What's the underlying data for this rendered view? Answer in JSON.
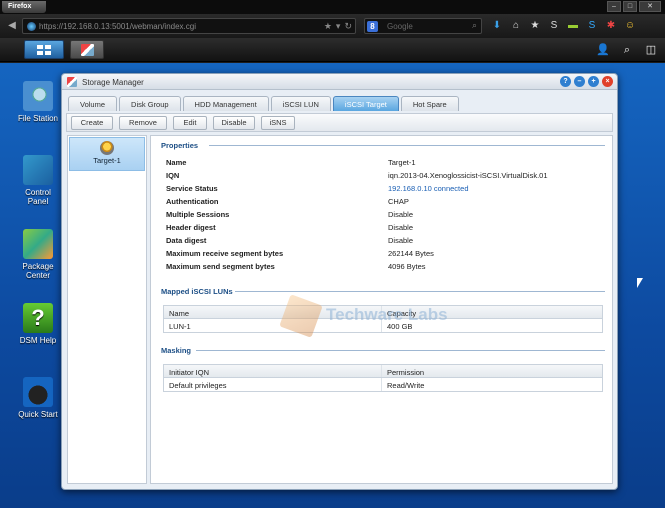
{
  "browser": {
    "menu_label": "Firefox",
    "url": "https://192.168.0.13:5001/webman/index.cgi",
    "search_engine_letter": "8",
    "search_placeholder": "Google",
    "window_controls": [
      "–",
      "□",
      "✕"
    ]
  },
  "desktop": {
    "icons": [
      {
        "label": "File Station",
        "icon": "file-station-icon"
      },
      {
        "label": "Control Panel",
        "icon": "control-panel-icon"
      },
      {
        "label": "Package Center",
        "icon": "package-center-icon"
      },
      {
        "label": "DSM Help",
        "icon": "help-icon",
        "glyph": "?"
      },
      {
        "label": "Quick Start",
        "icon": "quick-start-icon"
      }
    ]
  },
  "window": {
    "title": "Storage Manager",
    "tabs": [
      "Volume",
      "Disk Group",
      "HDD Management",
      "iSCSI LUN",
      "iSCSI Target",
      "Hot Spare"
    ],
    "active_tab": "iSCSI Target",
    "toolbar": {
      "create": "Create",
      "remove": "Remove",
      "edit": "Edit",
      "disable": "Disable",
      "isns": "iSNS"
    },
    "sidebar": {
      "items": [
        {
          "label": "Target-1"
        }
      ]
    },
    "properties": {
      "title": "Properties",
      "rows": [
        {
          "label": "Name",
          "value": "Target-1"
        },
        {
          "label": "IQN",
          "value": "iqn.2013-04.Xenoglossicist-iSCSI.VirtualDisk.01"
        },
        {
          "label": "Service Status",
          "value": "192.168.0.10 connected"
        },
        {
          "label": "Authentication",
          "value": "CHAP"
        },
        {
          "label": "Multiple Sessions",
          "value": "Disable"
        },
        {
          "label": "Header digest",
          "value": "Disable"
        },
        {
          "label": "Data digest",
          "value": "Disable"
        },
        {
          "label": "Maximum receive segment bytes",
          "value": "262144 Bytes"
        },
        {
          "label": "Maximum send segment bytes",
          "value": "4096 Bytes"
        }
      ]
    },
    "mapped_luns": {
      "title": "Mapped iSCSI LUNs",
      "columns": [
        "Name",
        "Capacity"
      ],
      "rows": [
        {
          "name": "LUN-1",
          "capacity": "400 GB"
        }
      ]
    },
    "masking": {
      "title": "Masking",
      "columns": [
        "Initiator IQN",
        "Permission"
      ],
      "rows": [
        {
          "iqn": "Default privileges",
          "permission": "Read/Write"
        }
      ]
    }
  },
  "watermark": {
    "text": "Techware Labs"
  },
  "colors": {
    "desktop": "#1565c0",
    "active_tab": "#5aa6e0",
    "section_title": "#1d4f86",
    "link": "#1a5fb4"
  }
}
